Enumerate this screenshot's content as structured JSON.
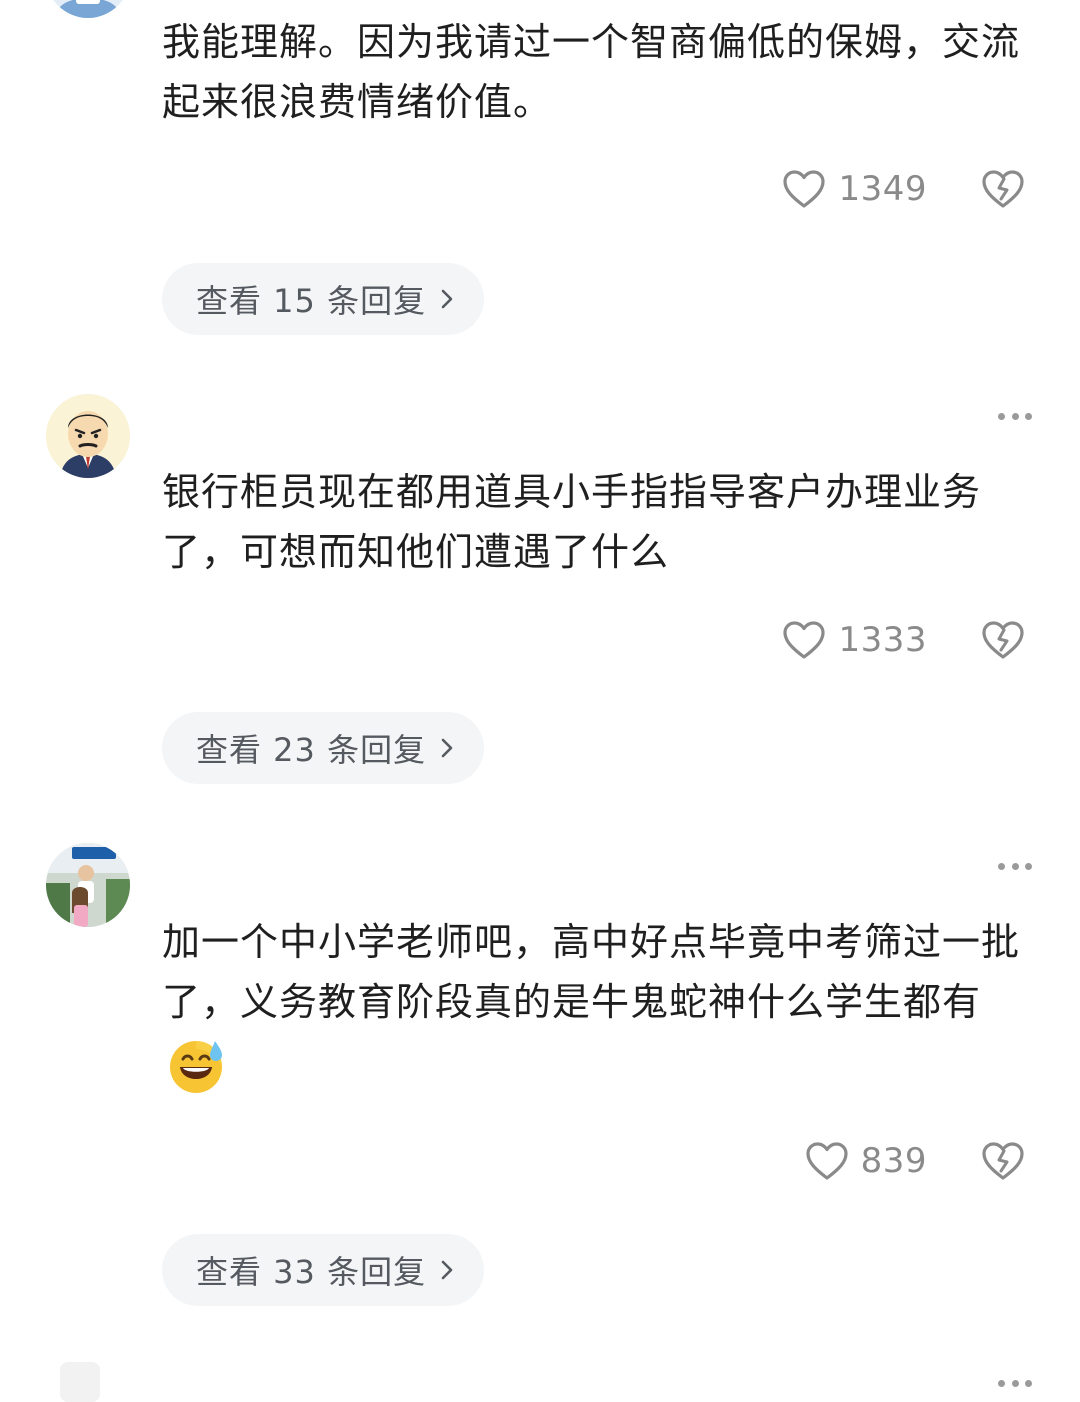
{
  "comments": [
    {
      "text": "我能理解。因为我请过一个智商偏低的保姆，交流起来很浪费情绪价值。",
      "likes": "1349",
      "replies_label": "查看 15 条回复"
    },
    {
      "text": "银行柜员现在都用道具小手指指导客户办理业务了，可想而知他们遭遇了什么",
      "likes": "1333",
      "replies_label": "查看 23 条回复"
    },
    {
      "text": "加一个中小学老师吧，高中好点毕竟中考筛过一批了，义务教育阶段真的是牛鬼蛇神什么学生都有",
      "likes": "839",
      "replies_label": "查看 33 条回复",
      "emoji": "sweat-smile-emoji"
    }
  ],
  "icons": {
    "like": "heart-outline-icon",
    "dislike": "broken-heart-icon",
    "more": "more-dots-icon",
    "chevron": "chevron-right-icon"
  },
  "colors": {
    "text": "#1f1f1f",
    "count": "#8a8a8a",
    "reply_bg": "#f4f5f7",
    "reply_text": "#555a60"
  }
}
